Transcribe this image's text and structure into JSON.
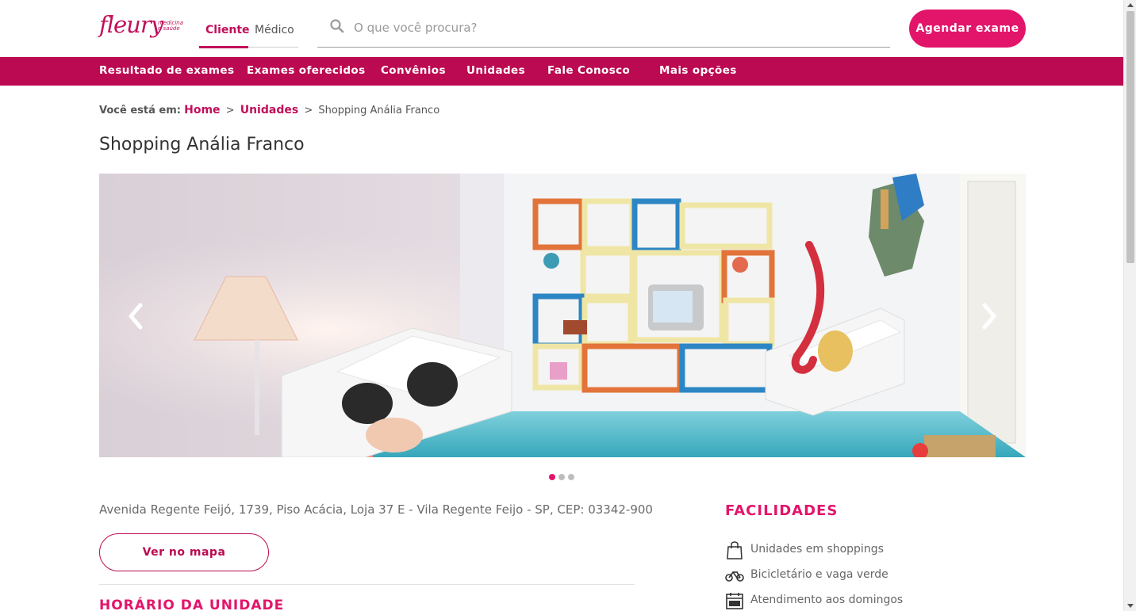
{
  "brand": {
    "logo_text": "fleury",
    "tagline_line1": "medicina",
    "tagline_line2": "e saúde",
    "accent": "#e2156b",
    "nav_bg": "#bb0a51"
  },
  "audience_tabs": [
    {
      "label": "Cliente",
      "active": true
    },
    {
      "label": "Médico",
      "active": false
    }
  ],
  "search": {
    "placeholder": "O que você procura?",
    "value": "",
    "icon": "search-icon"
  },
  "cta": {
    "label": "Agendar exame"
  },
  "nav": [
    {
      "label": "Resultado de exames"
    },
    {
      "label": "Exames oferecidos"
    },
    {
      "label": "Convênios"
    },
    {
      "label": "Unidades"
    },
    {
      "label": "Fale Conosco"
    },
    {
      "label": "Mais opções"
    }
  ],
  "breadcrumb": {
    "prefix": "Você está em:",
    "items": [
      {
        "label": "Home",
        "link": true
      },
      {
        "label": "Unidades",
        "link": true
      },
      {
        "label": "Shopping Anália Franco",
        "link": false
      }
    ],
    "separator": ">"
  },
  "page_title": "Shopping Anália Franco",
  "carousel": {
    "slide_count": 3,
    "active_index": 0,
    "prev_icon": "chevron-left-icon",
    "next_icon": "chevron-right-icon"
  },
  "address": "Avenida Regente Feijó, 1739, Piso Acácia, Loja 37 E - Vila Regente Feijo - SP, CEP: 03342-900",
  "map_button": {
    "label": "Ver no mapa"
  },
  "hours_section_title": "HORÁRIO DA UNIDADE",
  "facilities": {
    "title": "FACILIDADES",
    "items": [
      {
        "label": "Unidades em shoppings",
        "icon": "shopping-bag-icon"
      },
      {
        "label": "Bicicletário e vaga verde",
        "icon": "bicycle-icon"
      },
      {
        "label": "Atendimento aos domingos",
        "icon": "calendar-dom-icon"
      }
    ]
  }
}
